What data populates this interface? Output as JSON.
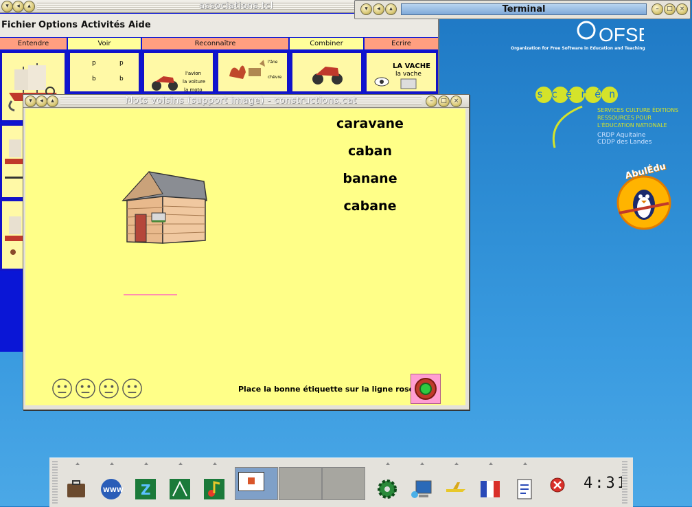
{
  "assoc_window": {
    "title": "associations.tcl",
    "menu": [
      "Fichier",
      "Options",
      "Activités",
      "Aide"
    ],
    "tabs": [
      "Entendre",
      "Voir",
      "Reconnaître",
      "Combiner",
      "Ecrire"
    ],
    "card_texts": {
      "voir": [
        "p",
        "p",
        "b",
        "b"
      ],
      "reconnaitre": [
        "l'avion",
        "la voiture",
        "la moto"
      ],
      "reconnaitre2": [
        "l'âne",
        "chèvre"
      ],
      "ecrire": [
        "LA VACHE",
        "la vache"
      ]
    }
  },
  "terminal": {
    "title": "Terminal"
  },
  "desktop": {
    "ofset": {
      "logo": "OFSET",
      "tagline": "Organization for Free Software in Education and Teaching"
    },
    "sceren": {
      "logo": "scérén",
      "lines": [
        "SERVICES CULTURE ÉDITIONS",
        "RESSOURCES POUR",
        "L'ÉDUCATION NATIONALE"
      ],
      "crdp": [
        "CRDP Aquitaine",
        "CDDP des Landes"
      ]
    },
    "abuledu": {
      "logo": "AbulÉdu"
    }
  },
  "dialog": {
    "title": "Mots voisins (support image) - constructions.cat",
    "words": [
      "caravane",
      "caban",
      "banane",
      "cabane"
    ],
    "instruction": "Place la bonne étiquette sur la ligne rose.",
    "image": "house-drawing"
  },
  "taskbar": {
    "clock": "4:31",
    "launchers": [
      "briefcase-icon",
      "www-globe-icon",
      "writer-icon",
      "graphics-icon",
      "music-icon"
    ],
    "tools": [
      "gear-icon",
      "network-computer-icon",
      "airplane-icon",
      "flag-icon",
      "document-icon"
    ]
  }
}
